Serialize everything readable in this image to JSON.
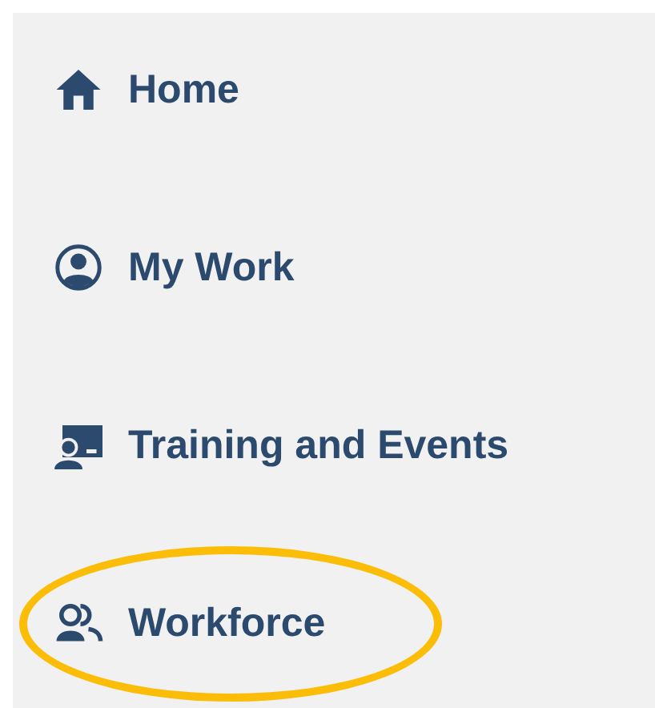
{
  "sidebar": {
    "items": [
      {
        "label": "Home",
        "kind": "home",
        "highlighted": false
      },
      {
        "label": "My Work",
        "kind": "person",
        "highlighted": false
      },
      {
        "label": "Training and Events",
        "kind": "training",
        "highlighted": false
      },
      {
        "label": "Workforce",
        "kind": "people",
        "highlighted": true
      }
    ]
  }
}
